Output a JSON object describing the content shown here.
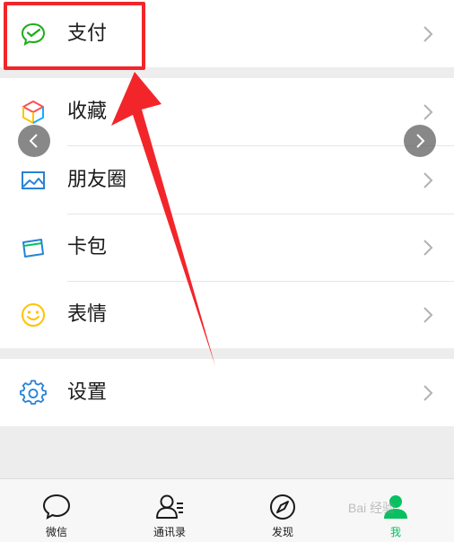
{
  "menu": {
    "pay": {
      "label": "支付",
      "icon": "wechat-pay-icon"
    },
    "favorites": {
      "label": "收藏",
      "icon": "cube-icon"
    },
    "moments": {
      "label": "朋友圈",
      "icon": "image-icon"
    },
    "cards": {
      "label": "卡包",
      "icon": "card-icon"
    },
    "stickers": {
      "label": "表情",
      "icon": "smiley-icon"
    },
    "settings": {
      "label": "设置",
      "icon": "gear-icon"
    }
  },
  "tabbar": {
    "tabs": [
      {
        "label": "微信",
        "icon": "chat-bubble-icon"
      },
      {
        "label": "通讯录",
        "icon": "contacts-icon"
      },
      {
        "label": "发现",
        "icon": "compass-icon"
      },
      {
        "label": "我",
        "icon": "me-icon"
      }
    ]
  },
  "watermark": "Bai 经验",
  "colors": {
    "accent_green": "#07c160",
    "highlight_red": "#f2262a",
    "background": "#ededed"
  }
}
